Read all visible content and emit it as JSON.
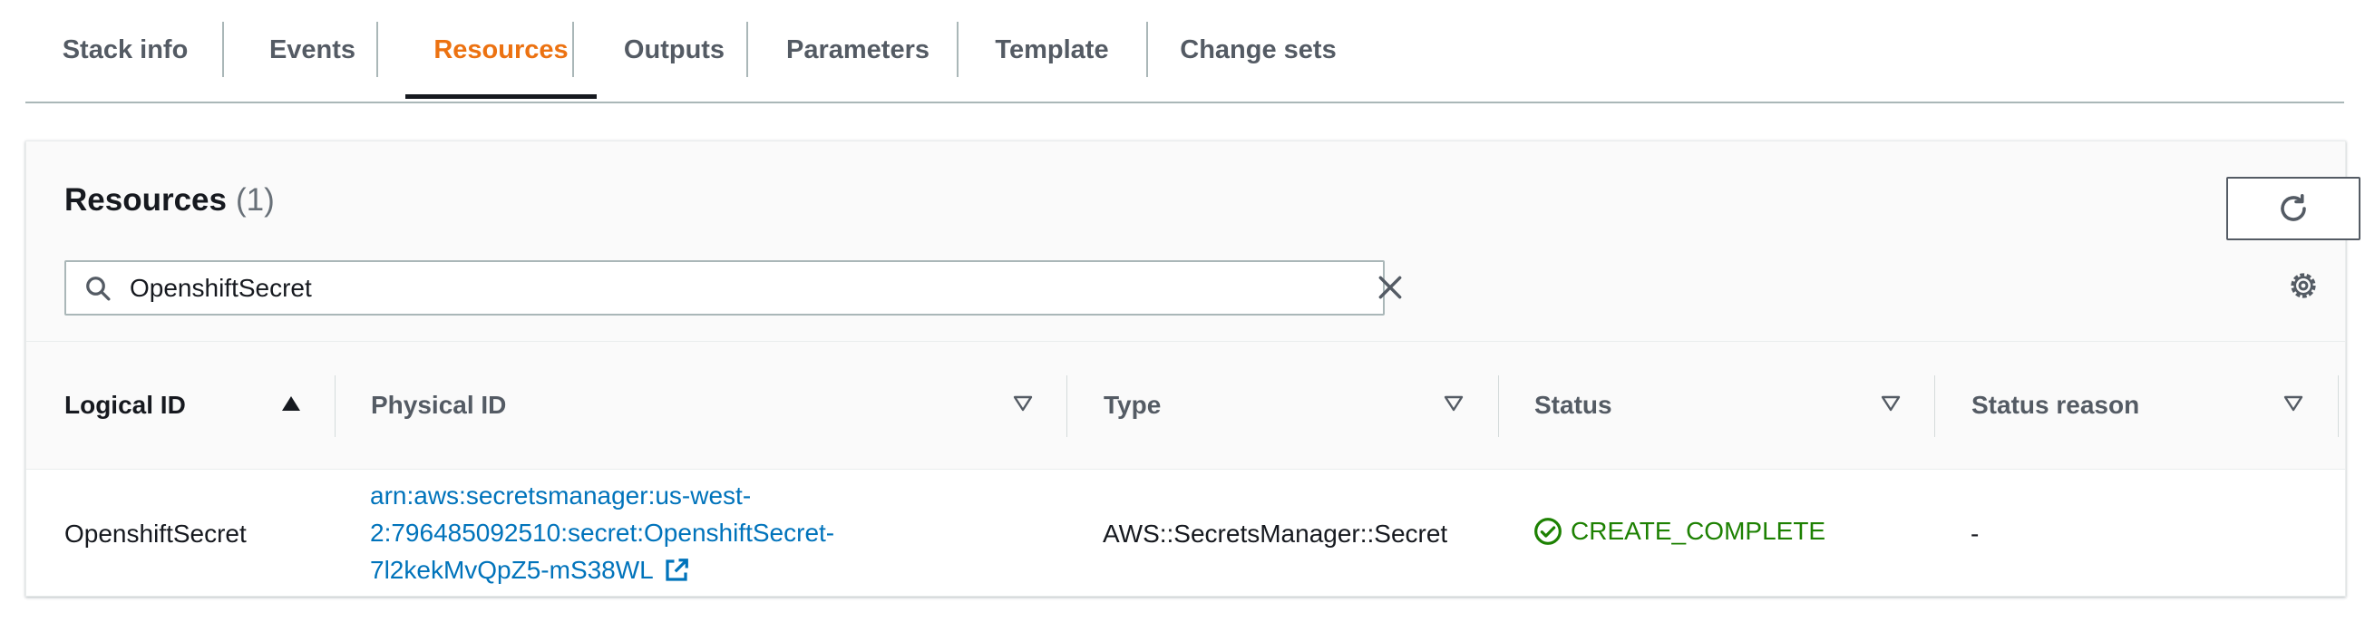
{
  "tabs": [
    {
      "label": "Stack info"
    },
    {
      "label": "Events"
    },
    {
      "label": "Resources",
      "active": true
    },
    {
      "label": "Outputs"
    },
    {
      "label": "Parameters"
    },
    {
      "label": "Template"
    },
    {
      "label": "Change sets"
    }
  ],
  "resources": {
    "title": "Resources",
    "count": "(1)",
    "refresh_icon": "refresh-icon",
    "settings_icon": "gear-icon",
    "search": {
      "value": "OpenshiftSecret",
      "icon": "search-icon",
      "clear_icon": "close-icon"
    },
    "columns": [
      {
        "label": "Logical ID",
        "sort": "ascending"
      },
      {
        "label": "Physical ID",
        "sort": "none"
      },
      {
        "label": "Type",
        "sort": "none"
      },
      {
        "label": "Status",
        "sort": "none"
      },
      {
        "label": "Status reason",
        "sort": "none"
      }
    ],
    "rows": [
      {
        "logical_id": "OpenshiftSecret",
        "physical_id_lines": [
          "arn:aws:secretsmanager:us-west-",
          "2:796485092510:secret:OpenshiftSecret-",
          "7l2kekMvQpZ5-mS38WL"
        ],
        "type": "AWS::SecretsManager::Secret",
        "status": "CREATE_COMPLETE",
        "status_reason": "-"
      }
    ]
  },
  "colors": {
    "accent": "#ec7211",
    "link": "#0073bb",
    "success": "#1d8102",
    "text": "#16191f",
    "muted": "#545b64"
  }
}
